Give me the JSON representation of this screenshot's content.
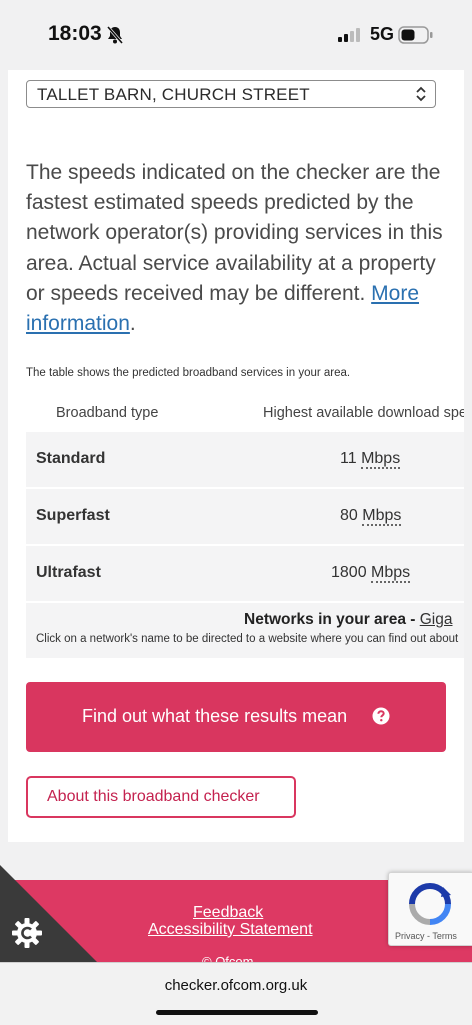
{
  "status_bar": {
    "time": "18:03",
    "network": "5G"
  },
  "address_select": {
    "value": "TALLET BARN, CHURCH STREET"
  },
  "info": {
    "text": "The speeds indicated on the checker are the fastest estimated speeds predicted by the network operator(s) providing services in this area. Actual service availability at a property or speeds received may be different.",
    "link": "More information",
    "end": "."
  },
  "table": {
    "caption": "The table shows the predicted broadband services in your area.",
    "headers": [
      "Broadband type",
      "Highest available download speed"
    ],
    "rows": [
      {
        "type": "Standard",
        "value": "11",
        "unit": "Mbps"
      },
      {
        "type": "Superfast",
        "value": "80",
        "unit": "Mbps"
      },
      {
        "type": "Ultrafast",
        "value": "1800",
        "unit": "Mbps"
      }
    ],
    "networks_label": "Networks in your area - ",
    "networks_link": "Giga",
    "networks_desc": "Click on a network's name to be directed to a website where you can find out about"
  },
  "buttons": {
    "results": "Find out what these results mean",
    "about": "About this broadband checker"
  },
  "footer": {
    "feedback": "Feedback",
    "accessibility": "Accessibility Statement",
    "copyright": "© Ofcom"
  },
  "recaptcha": {
    "privacy": "Privacy",
    "sep": " - ",
    "terms": "Terms"
  },
  "browser": {
    "url": "checker.ofcom.org.uk"
  },
  "colors": {
    "accent": "#d9365f",
    "link": "#2a70b0",
    "footer": "#dd3963"
  }
}
